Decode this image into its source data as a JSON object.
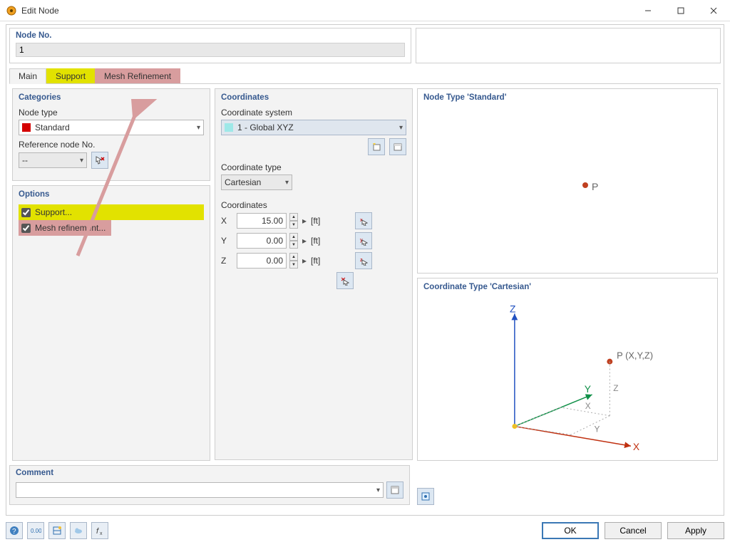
{
  "window": {
    "title": "Edit Node"
  },
  "node_no": {
    "label": "Node No.",
    "value": "1"
  },
  "tabs": {
    "main": "Main",
    "support": "Support",
    "mesh_refinement": "Mesh Refinement"
  },
  "categories": {
    "header": "Categories",
    "node_type_label": "Node type",
    "node_type_value": "Standard",
    "node_type_color": "#d40000",
    "ref_node_label": "Reference node No.",
    "ref_node_value": "--"
  },
  "options": {
    "header": "Options",
    "support": "Support...",
    "mesh_refinement": "Mesh refinement..."
  },
  "coordinates": {
    "header": "Coordinates",
    "system_label": "Coordinate system",
    "system_value": "1 - Global XYZ",
    "system_color": "#9ee8e8",
    "type_label": "Coordinate type",
    "type_value": "Cartesian",
    "sub_label": "Coordinates",
    "x_label": "X",
    "x_value": "15.00",
    "x_unit": "[ft]",
    "y_label": "Y",
    "y_value": "0.00",
    "y_unit": "[ft]",
    "z_label": "Z",
    "z_value": "0.00",
    "z_unit": "[ft]"
  },
  "preview": {
    "node_type_header": "Node Type 'Standard'",
    "point_label": "P",
    "cartesian_header": "Coordinate Type 'Cartesian'",
    "axis_x": "X",
    "axis_y": "Y",
    "axis_z": "Z",
    "diagram_point": "P (X,Y,Z)"
  },
  "comment": {
    "header": "Comment",
    "value": ""
  },
  "buttons": {
    "ok": "OK",
    "cancel": "Cancel",
    "apply": "Apply"
  }
}
